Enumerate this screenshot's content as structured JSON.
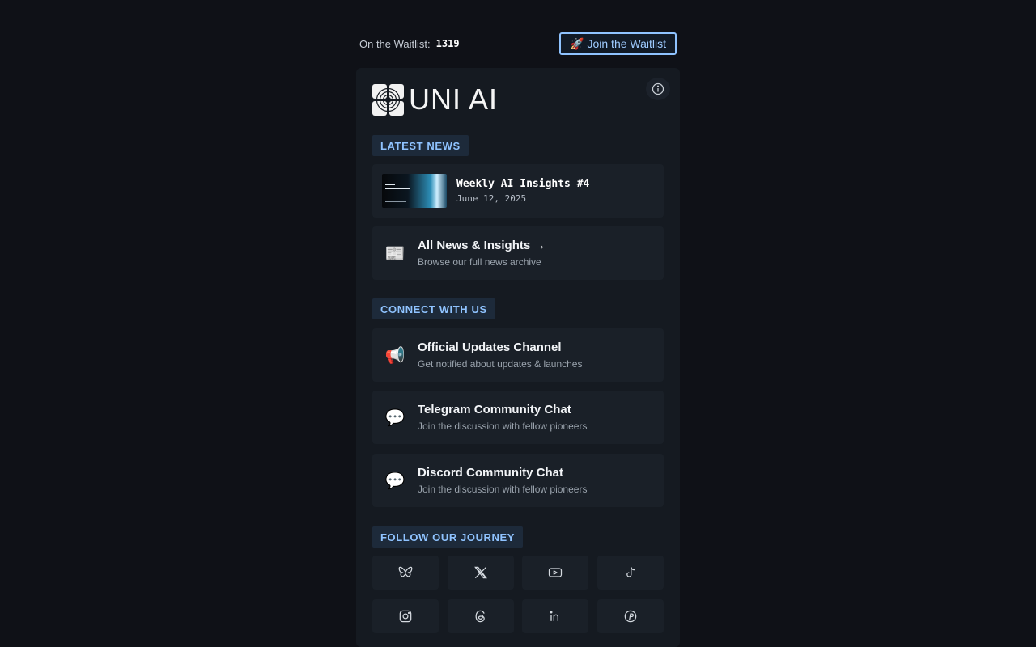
{
  "header": {
    "waitlist_label": "On the Waitlist:",
    "waitlist_count": "1319",
    "join_label": "Join the Waitlist",
    "join_emoji": "🚀"
  },
  "brand": {
    "name": "UNI AI"
  },
  "sections": {
    "news": "LATEST NEWS",
    "connect": "CONNECT WITH US",
    "follow": "FOLLOW OUR JOURNEY"
  },
  "news_item": {
    "title": "Weekly AI Insights #4",
    "date": "June 12, 2025"
  },
  "all_news": {
    "emoji": "📰",
    "title": "All News & Insights →",
    "sub": "Browse our full news archive"
  },
  "channels": [
    {
      "emoji": "📢",
      "title": "Official Updates Channel",
      "sub": "Get notified about updates & launches"
    },
    {
      "emoji": "💬",
      "title": "Telegram Community Chat",
      "sub": "Join the discussion with fellow pioneers"
    },
    {
      "emoji": "💬",
      "title": "Discord Community Chat",
      "sub": "Join the discussion with fellow pioneers"
    }
  ],
  "socials": [
    "bluesky-icon",
    "x-icon",
    "youtube-icon",
    "tiktok-icon",
    "instagram-icon",
    "threads-icon",
    "linkedin-icon",
    "pinterest-icon"
  ],
  "colors": {
    "accent": "#8fc3ff",
    "background": "#0f1117",
    "card": "#151a21",
    "tile": "#1a2028"
  }
}
